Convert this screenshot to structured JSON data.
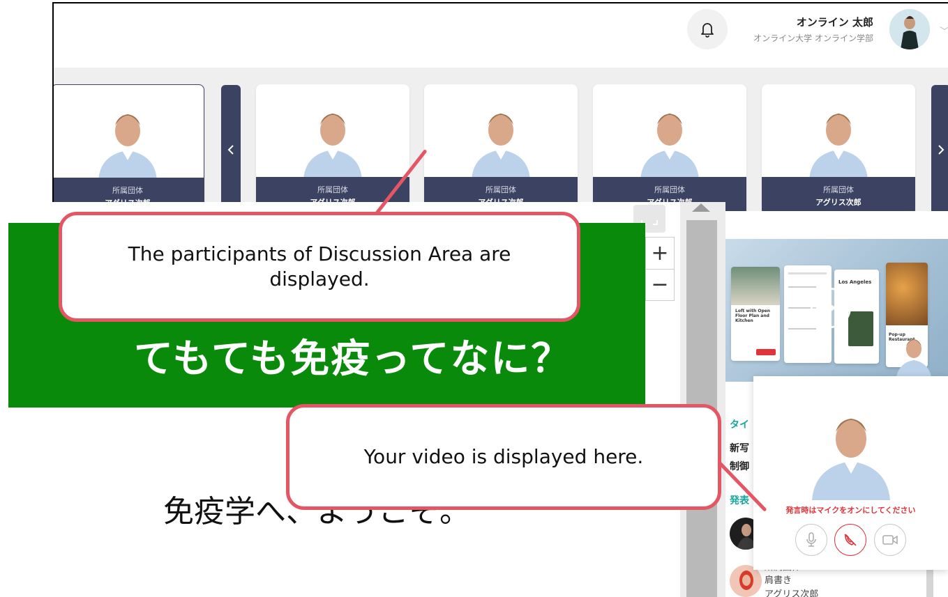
{
  "header": {
    "user_name": "オンライン 太郎",
    "user_org": "オンライン大学 オンライン学部"
  },
  "participants": [
    {
      "org": "所属団体",
      "name": "アグリス次郎"
    },
    {
      "org": "所属団体",
      "name": "アグリス次郎"
    },
    {
      "org": "所属団体",
      "name": "アグリス次郎"
    },
    {
      "org": "所属団体",
      "name": "アグリス次郎"
    },
    {
      "org": "所属団体",
      "name": "アグリス次郎"
    }
  ],
  "slide": {
    "green_text": "てもても免疫ってなに？",
    "welcome_text": "免疫学へ、ようこそ。"
  },
  "zoom": {
    "plus": "+",
    "minus": "−"
  },
  "video_thumb": {
    "card1_title": "Loft with Open Floor Plan and Kitchen",
    "card2_title": "Los Angeles",
    "card3_title": "Pop-up Restaurant"
  },
  "right_panel": {
    "title_label": "タイ",
    "row1": "新写",
    "row2": "制御",
    "presenter_label": "発表",
    "presenter2_org": "所属団体",
    "presenter2_title": "肩書き",
    "presenter2_name": "アグリス次郎"
  },
  "self_video": {
    "note": "発言時はマイクをオンにしてください"
  },
  "callouts": {
    "participants": "The participants of Discussion Area are displayed.",
    "your_video": "Your video is displayed here."
  },
  "colors": {
    "accent_navy": "#3b4262",
    "callout_red": "#e45664",
    "slide_green": "#0a8a0a",
    "teal": "#1aa59d",
    "alert_red": "#e0333a"
  }
}
